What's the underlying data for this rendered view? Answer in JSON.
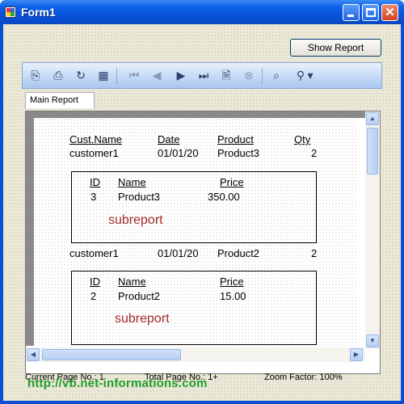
{
  "window": {
    "title": "Form1",
    "close_glyph": "✕"
  },
  "show_report_button": "Show Report",
  "toolbar": {
    "icons": [
      "export-icon",
      "print-icon",
      "refresh-icon",
      "tree-icon",
      "first-page-icon",
      "prev-page-icon",
      "next-page-icon",
      "last-page-icon",
      "goto-page-icon",
      "stop-icon",
      "search-icon",
      "zoom-icon"
    ],
    "glyphs": {
      "export": "⎘",
      "print": "⎙",
      "refresh": "↻",
      "tree": "▦",
      "first": "⏮",
      "prev": "◀",
      "next": "▶",
      "last": "⏭",
      "goto": "🗎",
      "stop": "⊗",
      "search": "⌕",
      "zoom": "⚲",
      "dropdown": "▾"
    }
  },
  "tabs": [
    "Main Report"
  ],
  "report": {
    "headers": {
      "cust": "Cust.Name",
      "date": "Date",
      "product": "Product",
      "qty": "Qty"
    },
    "rows": [
      {
        "cust": "customer1",
        "date": "01/01/20",
        "product": "Product3",
        "qty": "2",
        "sub": {
          "id_h": "ID",
          "name_h": "Name",
          "price_h": "Price",
          "id": "3",
          "name": "Product3",
          "price": "350.00",
          "label": "subreport"
        }
      },
      {
        "cust": "customer1",
        "date": "01/01/20",
        "product": "Product2",
        "qty": "2",
        "sub": {
          "id_h": "ID",
          "name_h": "Name",
          "price_h": "Price",
          "id": "2",
          "name": "Product2",
          "price": "15.00",
          "label": "subreport"
        }
      }
    ]
  },
  "scrollbars": {
    "up": "▲",
    "down": "▼",
    "left": "◀",
    "right": "▶"
  },
  "status": {
    "current_page": "Current Page No.: 1",
    "total_page": "Total Page No.: 1+",
    "zoom": "Zoom Factor: 100%"
  },
  "watermark": "http://vb.net-informations.com",
  "colors": {
    "title_bar": "#0a5fe8",
    "subreport_label": "#a52a2a",
    "watermark": "#1f9d2a"
  }
}
